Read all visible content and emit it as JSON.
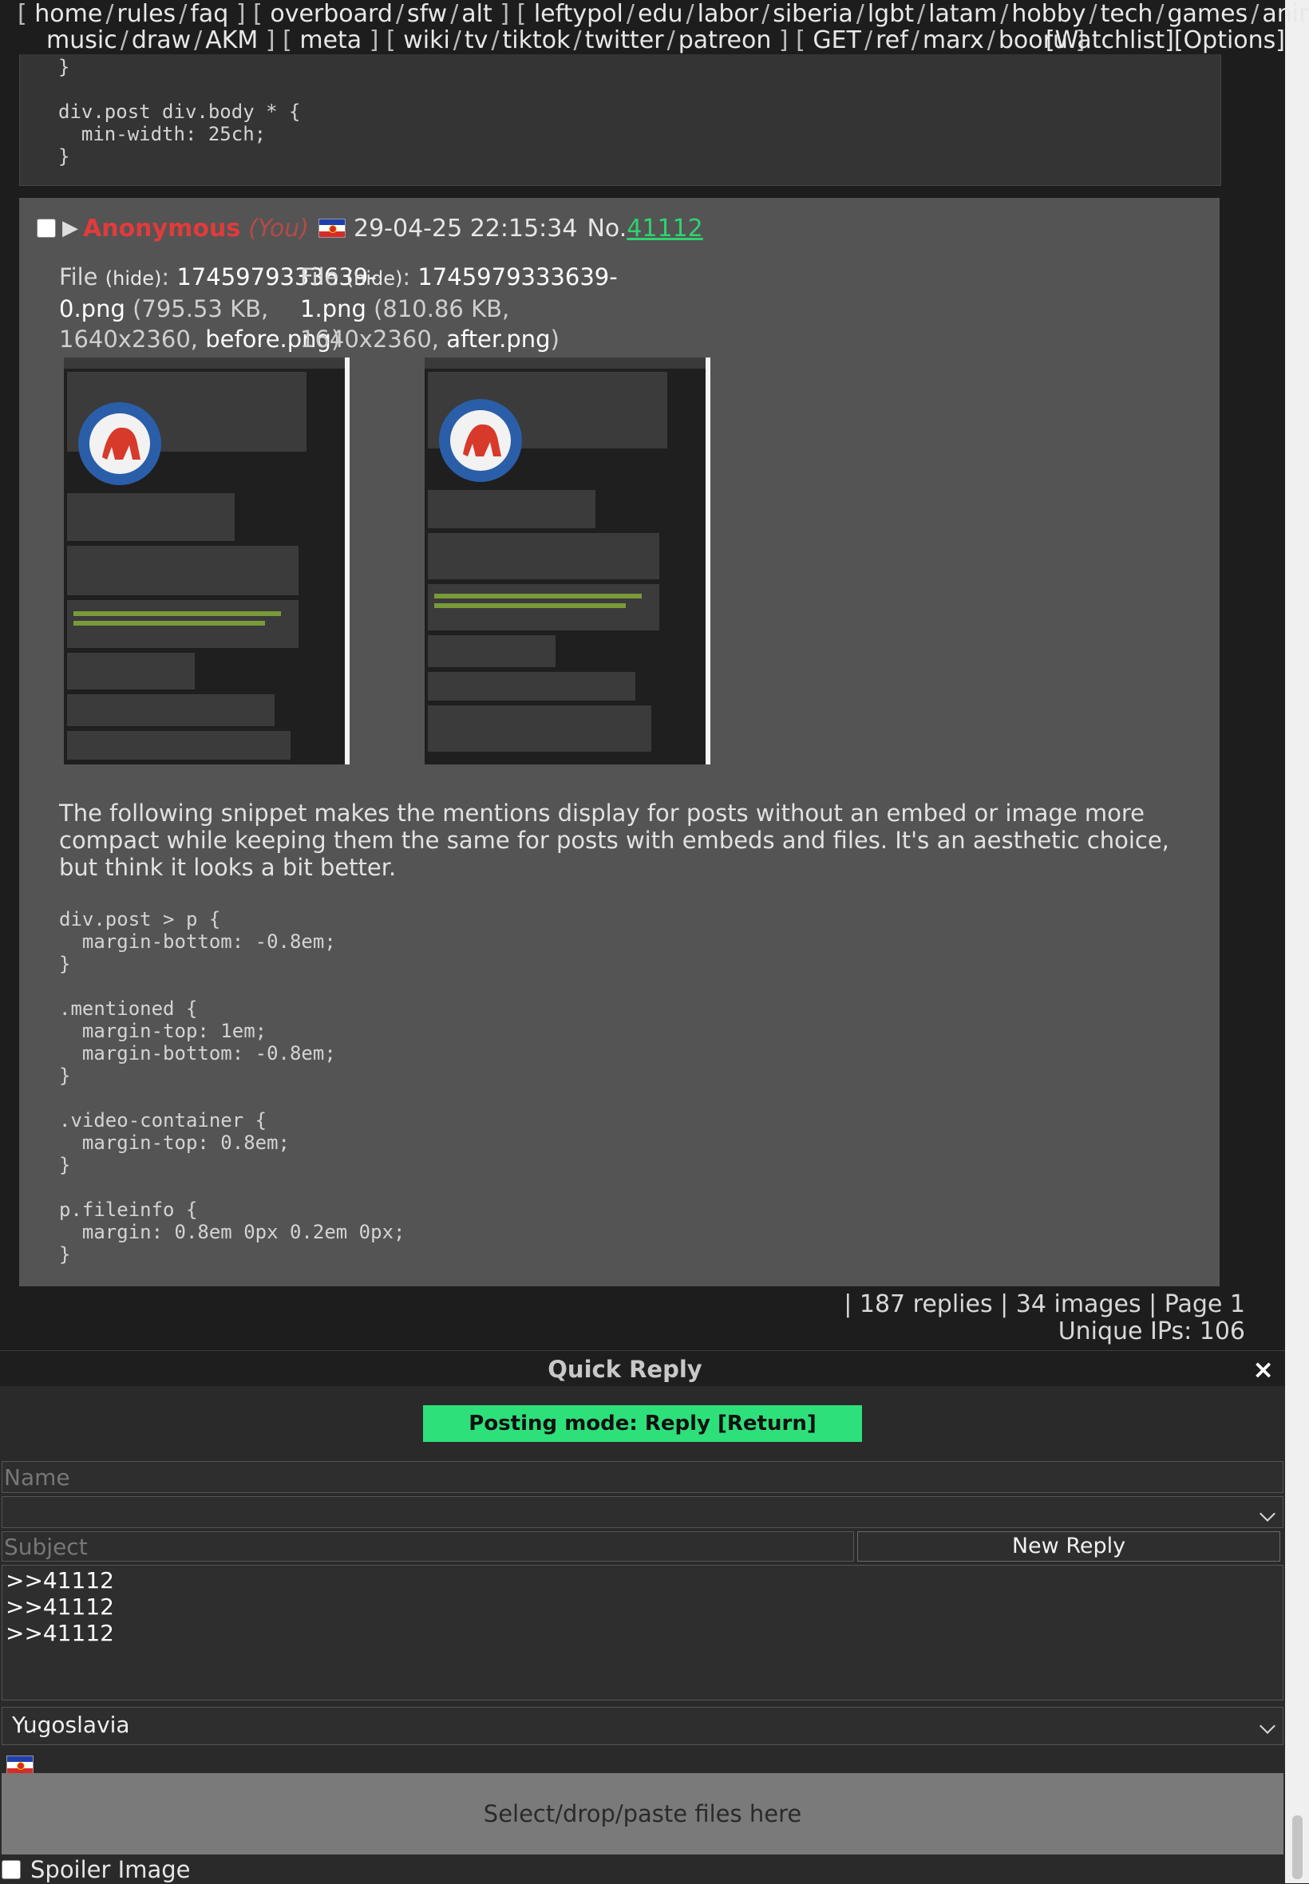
{
  "nav": {
    "line1": [
      "home",
      "rules",
      "faq",
      "overboard",
      "sfw",
      "alt",
      "leftypol",
      "edu",
      "labor",
      "siberia",
      "lgbt",
      "latam",
      "hobby",
      "tech",
      "games",
      "anime"
    ],
    "line2": [
      "music",
      "draw",
      "AKM",
      "meta",
      "wiki",
      "tv",
      "tiktok",
      "twitter",
      "patreon",
      "GET",
      "ref",
      "marx",
      "booru"
    ],
    "watchlist": "[Watchlist]",
    "options": "[Options]"
  },
  "prev_post": {
    "code": "}\n\ndiv.post div.body * {\n  min-width: 25ch;\n}"
  },
  "post": {
    "name": "Anonymous",
    "you": "(You)",
    "date": "29-04-25 22:15:34",
    "no_label": "No.",
    "no": "41112",
    "files": [
      {
        "label": "File",
        "hide": "(hide)",
        "filename": "1745979333639-0.png",
        "size": "(795.53 KB,",
        "dims": "1640x2360,",
        "orig": "before.png",
        "close": ")"
      },
      {
        "label": "File",
        "hide": "(hide)",
        "filename": "1745979333639-1.png",
        "size": "(810.86 KB,",
        "dims": "1640x2360,",
        "orig": "after.png",
        "close": ")"
      }
    ],
    "body": "The following snippet makes the mentions display for posts without an embed or image more compact while keeping them the same for posts with embeds and files. It's an aesthetic choice, but think it looks a bit better.",
    "code": "div.post > p {\n  margin-bottom: -0.8em;\n}\n\n.mentioned {\n  margin-top: 1em;\n  margin-bottom: -0.8em;\n}\n\n.video-container {\n  margin-top: 0.8em;\n}\n\np.fileinfo {\n  margin: 0.8em 0px 0.2em 0px;\n}"
  },
  "thread_stats": {
    "line1": "| 187 replies | 34 images | Page 1",
    "line2": "Unique IPs: 106"
  },
  "quick_reply": {
    "title": "Quick Reply",
    "close": "×",
    "posting_mode": "Posting mode: Reply [Return]",
    "name_placeholder": "Name",
    "subject_placeholder": "Subject",
    "new_reply": "New Reply",
    "message": ">>41112\n>>41112\n>>41112",
    "flag_select": "Yugoslavia",
    "dropzone": "Select/drop/paste files here",
    "spoiler": "Spoiler Image"
  },
  "icons": {
    "flag": "yugoslavia-flag-icon",
    "close": "close-icon",
    "expand": "triangle-expand-icon"
  }
}
